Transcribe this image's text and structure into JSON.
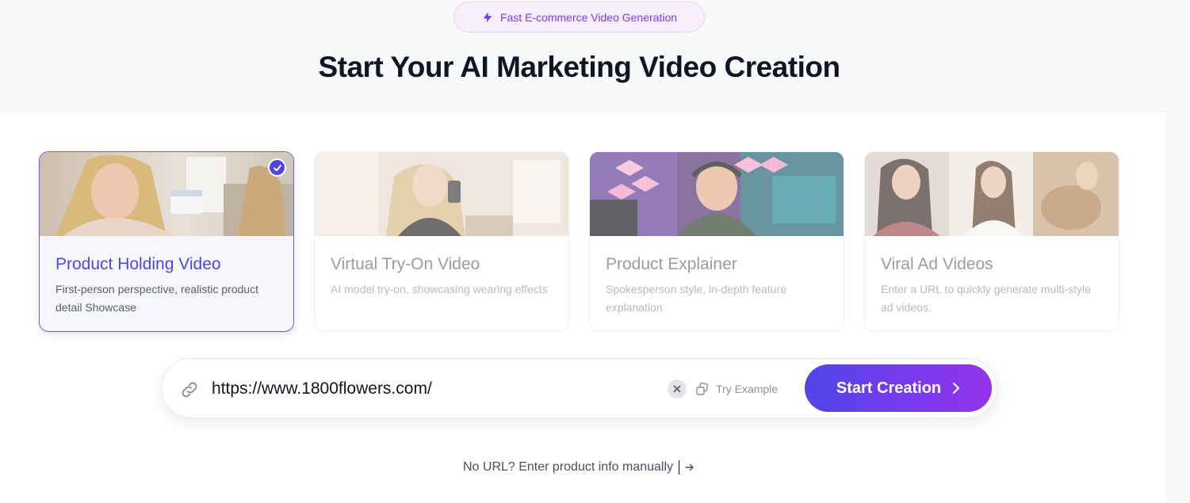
{
  "badge": {
    "icon": "lightning-icon",
    "label": "Fast E-commerce Video Generation"
  },
  "headline": "Start Your AI Marketing Video Creation",
  "cards": [
    {
      "title": "Product Holding Video",
      "description": "First-person perspective, realistic product detail Showcase",
      "selected": true
    },
    {
      "title": "Virtual Try-On Video",
      "description": "AI model try-on, showcasing wearing effects",
      "selected": false
    },
    {
      "title": "Product Explainer",
      "description": "Spokesperson style, in-depth feature explanation",
      "selected": false
    },
    {
      "title": "Viral Ad Videos",
      "description": "Enter a URL to quickly generate multi-style ad videos.",
      "selected": false
    }
  ],
  "url_bar": {
    "icon": "link-icon",
    "value": "https://www.1800flowers.com/",
    "clear_icon": "close-icon",
    "try_example_icon": "dice-icon",
    "try_example_label": "Try Example",
    "start_label": "Start Creation",
    "start_icon": "chevron-right-icon"
  },
  "manual_entry": {
    "label": "No URL? Enter product info manually",
    "icon": "arrow-right-icon"
  },
  "colors": {
    "accent": "#4f46e5",
    "accent_purple": "#9333ea",
    "badge_bg": "#f7effd"
  }
}
